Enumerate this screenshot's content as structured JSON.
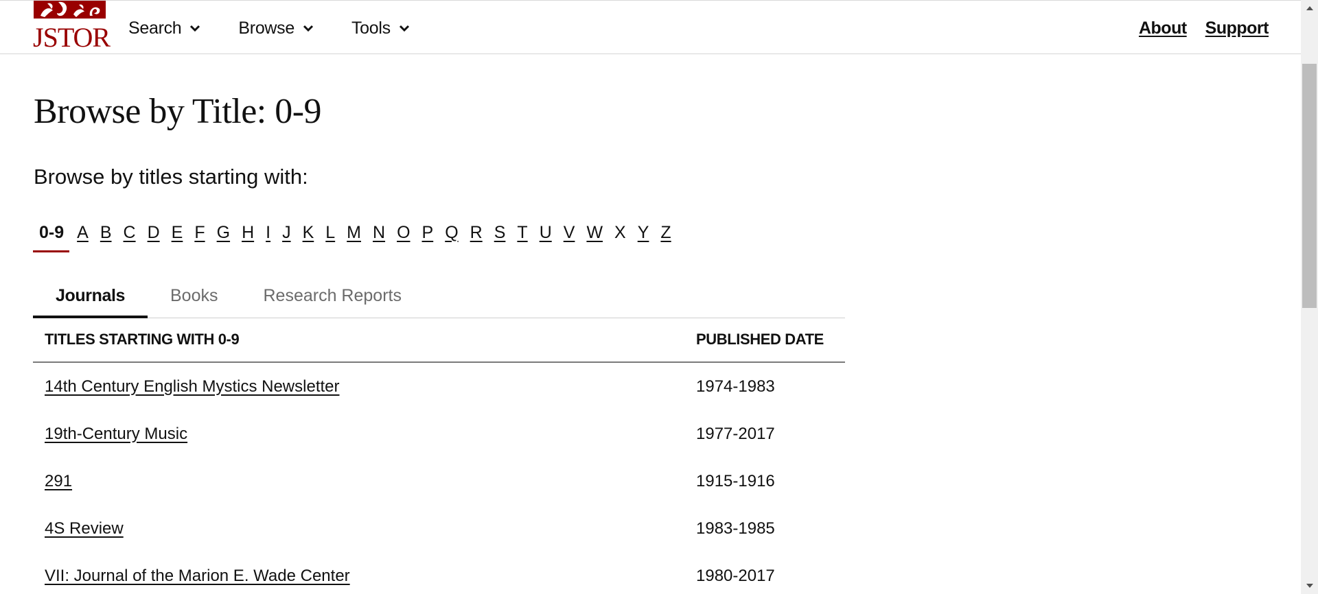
{
  "header": {
    "logo_text": "JSTOR",
    "nav": [
      {
        "label": "Search",
        "icon": "chevron-down-icon"
      },
      {
        "label": "Browse",
        "icon": "chevron-down-icon"
      },
      {
        "label": "Tools",
        "icon": "chevron-down-icon"
      }
    ],
    "utility_links": [
      {
        "label": "About"
      },
      {
        "label": "Support"
      }
    ]
  },
  "main": {
    "title": "Browse by Title: 0-9",
    "subtitle": "Browse by titles starting with:",
    "alphabet": {
      "active": "0-9",
      "items": [
        {
          "label": "0-9",
          "state": "active"
        },
        {
          "label": "A",
          "state": "link"
        },
        {
          "label": "B",
          "state": "link"
        },
        {
          "label": "C",
          "state": "link"
        },
        {
          "label": "D",
          "state": "link"
        },
        {
          "label": "E",
          "state": "link"
        },
        {
          "label": "F",
          "state": "link"
        },
        {
          "label": "G",
          "state": "link"
        },
        {
          "label": "H",
          "state": "link"
        },
        {
          "label": "I",
          "state": "link"
        },
        {
          "label": "J",
          "state": "link"
        },
        {
          "label": "K",
          "state": "link"
        },
        {
          "label": "L",
          "state": "link"
        },
        {
          "label": "M",
          "state": "link"
        },
        {
          "label": "N",
          "state": "link"
        },
        {
          "label": "O",
          "state": "link"
        },
        {
          "label": "P",
          "state": "link"
        },
        {
          "label": "Q",
          "state": "link"
        },
        {
          "label": "R",
          "state": "link"
        },
        {
          "label": "S",
          "state": "link"
        },
        {
          "label": "T",
          "state": "link"
        },
        {
          "label": "U",
          "state": "link"
        },
        {
          "label": "V",
          "state": "link"
        },
        {
          "label": "W",
          "state": "link"
        },
        {
          "label": "X",
          "state": "nolink"
        },
        {
          "label": "Y",
          "state": "link"
        },
        {
          "label": "Z",
          "state": "link"
        }
      ]
    },
    "tabs": [
      {
        "label": "Journals",
        "active": true
      },
      {
        "label": "Books",
        "active": false
      },
      {
        "label": "Research Reports",
        "active": false
      }
    ],
    "table": {
      "columns": [
        "TITLES STARTING WITH 0-9",
        "PUBLISHED DATE"
      ],
      "rows": [
        {
          "title": "14th Century English Mystics Newsletter",
          "date": "1974-1983"
        },
        {
          "title": "19th-Century Music",
          "date": "1977-2017"
        },
        {
          "title": "291",
          "date": "1915-1916"
        },
        {
          "title": "4S Review",
          "date": "1983-1985"
        },
        {
          "title": "VII: Journal of the Marion E. Wade Center",
          "date": "1980-2017"
        }
      ]
    }
  },
  "colors": {
    "brand_red": "#990000",
    "text": "#111111",
    "tab_inactive": "#6b6b6b",
    "scrollbar_track": "#f0f0f0",
    "scrollbar_thumb": "#bdbdbd"
  }
}
